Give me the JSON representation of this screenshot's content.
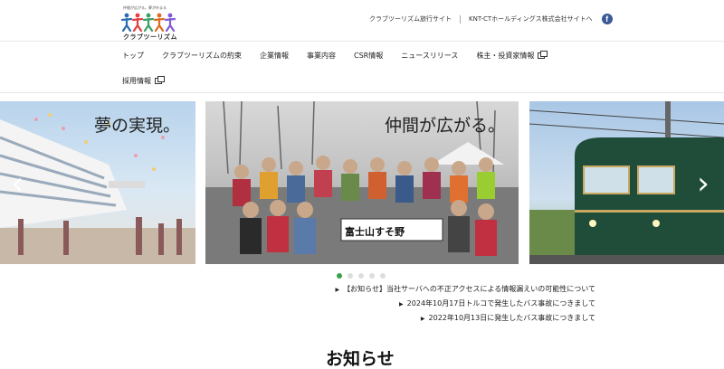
{
  "logo": {
    "tagline": "仲間が広がる。夢が叶まる",
    "name": "クラブツーリズム"
  },
  "toplinks": {
    "travel_site": "クラブツーリズム旅行サイト",
    "holdings_site": "KNT-CTホールディングス株式会社サイトへ",
    "facebook": "f"
  },
  "nav": {
    "items": [
      "トップ",
      "クラブツーリズムの約束",
      "企業情報",
      "事業内容",
      "CSR情報",
      "ニュースリリース",
      "株主・投資家情報"
    ],
    "recruit": "採用情報"
  },
  "carousel": {
    "slides": [
      {
        "caption": "夢の実現。"
      },
      {
        "caption": "仲間が広がる。"
      },
      {
        "caption": ""
      }
    ],
    "banner_text": "富士山すそ野",
    "dot_count": 5,
    "active_dot": 0,
    "prev_glyph": "‹",
    "next_glyph": "›"
  },
  "news": [
    "【お知らせ】当社サーバへの不正アクセスによる情報漏えいの可能性について",
    "2024年10月17日トルコで発生したバス事故につきまして",
    "2022年10月13日に発生したバス事故につきまして"
  ],
  "section": {
    "title": "お知らせ"
  },
  "colors": {
    "accent_green": "#3aa04a",
    "facebook_blue": "#3b5998",
    "train_green": "#1f4d3a"
  }
}
